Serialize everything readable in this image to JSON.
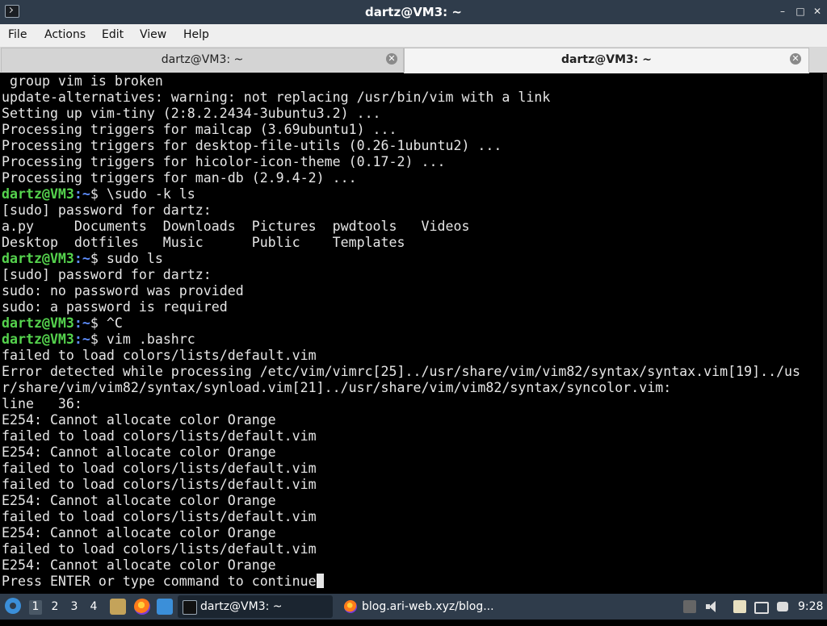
{
  "window": {
    "title": "dartz@VM3: ~",
    "minimize": "–",
    "maximize": "□",
    "close": "✕"
  },
  "menu": {
    "file": "File",
    "actions": "Actions",
    "edit": "Edit",
    "view": "View",
    "help": "Help"
  },
  "tabs": [
    {
      "label": "dartz@VM3: ~",
      "close": "✕"
    },
    {
      "label": "dartz@VM3: ~",
      "close": "✕"
    }
  ],
  "terminal": {
    "prompt_user": "dartz@VM3",
    "prompt_path": ":~",
    "lines": [
      " group vim is broken",
      "update-alternatives: warning: not replacing /usr/bin/vim with a link",
      "Setting up vim-tiny (2:8.2.2434-3ubuntu3.2) ...",
      "Processing triggers for mailcap (3.69ubuntu1) ...",
      "Processing triggers for desktop-file-utils (0.26-1ubuntu2) ...",
      "Processing triggers for hicolor-icon-theme (0.17-2) ...",
      "Processing triggers for man-db (2.9.4-2) ...",
      "$ \\sudo -k ls",
      "[sudo] password for dartz:",
      "a.py     Documents  Downloads  Pictures  pwdtools   Videos",
      "Desktop  dotfiles   Music      Public    Templates",
      "$ sudo ls",
      "[sudo] password for dartz:",
      "sudo: no password was provided",
      "sudo: a password is required",
      "$ ^C",
      "$ vim .bashrc",
      "failed to load colors/lists/default.vim",
      "Error detected while processing /etc/vim/vimrc[25]../usr/share/vim/vim82/syntax/syntax.vim[19]../us",
      "r/share/vim/vim82/syntax/synload.vim[21]../usr/share/vim/vim82/syntax/syncolor.vim:",
      "line   36:",
      "E254: Cannot allocate color Orange",
      "failed to load colors/lists/default.vim",
      "E254: Cannot allocate color Orange",
      "failed to load colors/lists/default.vim",
      "failed to load colors/lists/default.vim",
      "E254: Cannot allocate color Orange",
      "failed to load colors/lists/default.vim",
      "E254: Cannot allocate color Orange",
      "failed to load colors/lists/default.vim",
      "E254: Cannot allocate color Orange",
      "Press ENTER or type command to continue"
    ]
  },
  "taskbar": {
    "workspaces": [
      "1",
      "2",
      "3",
      "4"
    ],
    "tasks": [
      {
        "label": "dartz@VM3: ~",
        "icon": "terminal-icon"
      },
      {
        "label": "blog.ari-web.xyz/blog...",
        "icon": "firefox-icon"
      }
    ],
    "clock": "9:28"
  },
  "colors": {
    "prompt_user": "#55d34d",
    "prompt_path": "#5f8fff",
    "panel": "#2f3c4b"
  }
}
